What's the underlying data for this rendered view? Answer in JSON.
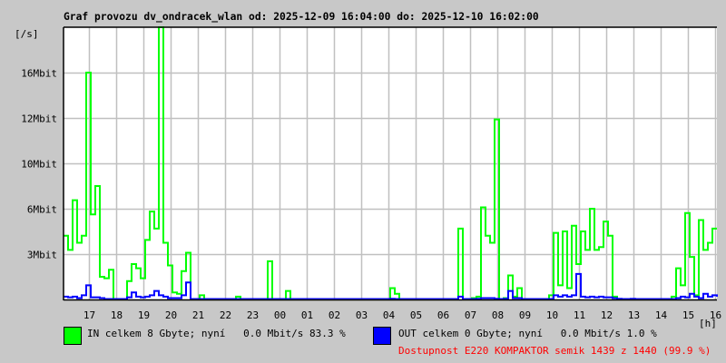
{
  "chart_data": {
    "type": "line",
    "title": "Graf provozu dv_ondracek_wlan od: 2025-12-09 16:04:00 do: 2025-12-10 16:02:00",
    "ylabel": "[/s]",
    "xlabel": "[h]",
    "ylim": [
      0,
      19.2
    ],
    "y_unit": "Mbit/s",
    "grid": true,
    "yticks": [
      {
        "value": 3.2,
        "label": "3Mbit"
      },
      {
        "value": 6.4,
        "label": "6Mbit"
      },
      {
        "value": 9.6,
        "label": "10Mbit"
      },
      {
        "value": 12.8,
        "label": "12Mbit"
      },
      {
        "value": 16,
        "label": "16Mbit"
      }
    ],
    "xticks": [
      "17",
      "18",
      "19",
      "20",
      "21",
      "22",
      "23",
      "00",
      "01",
      "02",
      "03",
      "04",
      "05",
      "06",
      "07",
      "08",
      "09",
      "10",
      "11",
      "12",
      "13",
      "14",
      "15",
      "16"
    ],
    "x_start_minutes_before_first_tick": 56,
    "sample_interval_minutes": 10,
    "series": [
      {
        "name": "IN",
        "color": "#00ff00",
        "values": [
          4.5,
          3.5,
          7,
          4,
          4.5,
          16,
          6,
          8,
          1.6,
          1.5,
          2.1,
          0,
          0,
          0,
          1.3,
          2.5,
          2.2,
          1.5,
          4.2,
          6.2,
          5,
          19.2,
          4,
          2.4,
          0.5,
          0.4,
          2,
          3.3,
          0,
          0,
          0.3,
          0,
          0,
          0,
          0,
          0,
          0,
          0,
          0.2,
          0,
          0,
          0,
          0,
          0,
          0,
          2.7,
          0,
          0,
          0,
          0.6,
          0,
          0,
          0,
          0,
          0,
          0,
          0,
          0,
          0,
          0,
          0,
          0,
          0,
          0,
          0,
          0,
          0,
          0,
          0,
          0,
          0,
          0,
          0.8,
          0.4,
          0,
          0,
          0,
          0,
          0,
          0,
          0,
          0,
          0,
          0,
          0,
          0,
          0,
          5,
          0,
          0,
          0.1,
          0.2,
          6.5,
          4.5,
          4,
          12.7,
          0,
          0.1,
          1.7,
          0.2,
          0.8,
          0,
          0,
          0,
          0,
          0,
          0,
          0.3,
          4.7,
          1,
          4.8,
          0.8,
          5.2,
          2.5,
          4.8,
          3.5,
          6.4,
          3.5,
          3.7,
          5.5,
          4.5,
          0.2,
          0,
          0,
          0,
          0,
          0,
          0,
          0,
          0,
          0,
          0,
          0,
          0,
          0.2,
          2.2,
          1,
          6.1,
          3,
          0.3,
          5.6,
          3.5,
          4,
          5
        ]
      },
      {
        "name": "OUT",
        "color": "#0000ff",
        "values": [
          0.2,
          0.15,
          0.2,
          0.1,
          0.3,
          1.0,
          0.15,
          0.15,
          0.1,
          0,
          0,
          0,
          0,
          0,
          0.15,
          0.5,
          0.2,
          0.15,
          0.2,
          0.3,
          0.6,
          0.3,
          0.2,
          0.1,
          0.1,
          0.1,
          0.3,
          1.2,
          0,
          0,
          0,
          0,
          0,
          0,
          0,
          0,
          0,
          0,
          0,
          0,
          0,
          0,
          0,
          0,
          0,
          0,
          0,
          0,
          0,
          0,
          0,
          0,
          0,
          0,
          0,
          0,
          0,
          0,
          0,
          0,
          0,
          0,
          0,
          0,
          0,
          0,
          0,
          0,
          0,
          0,
          0,
          0,
          0.05,
          0,
          0,
          0,
          0,
          0,
          0,
          0,
          0,
          0,
          0,
          0,
          0,
          0,
          0,
          0.2,
          0,
          0,
          0,
          0.05,
          0.1,
          0.1,
          0.1,
          0.05,
          0,
          0.05,
          0.6,
          0.1,
          0.1,
          0,
          0,
          0,
          0,
          0,
          0,
          0,
          0.3,
          0.2,
          0.3,
          0.2,
          0.3,
          1.8,
          0.2,
          0.15,
          0.2,
          0.15,
          0.2,
          0.15,
          0.15,
          0.1,
          0.05,
          0,
          0,
          0.05,
          0,
          0,
          0,
          0,
          0,
          0,
          0,
          0,
          0,
          0.1,
          0.2,
          0.15,
          0.4,
          0.2,
          0.1,
          0.4,
          0.2,
          0.3,
          0.2
        ]
      }
    ]
  },
  "legend": {
    "in": {
      "text": "IN celkem 8 Gbyte; nyní   0.0 Mbit/s 83.3 %",
      "color": "#00ff00"
    },
    "out": {
      "text": "OUT celkem 0 Gbyte; nyní   0.0 Mbit/s 1.0 %",
      "color": "#0000ff"
    },
    "availability": "Dostupnost E220 KOMPAKTOR semik 1439 z 1440 (99.9 %)"
  }
}
